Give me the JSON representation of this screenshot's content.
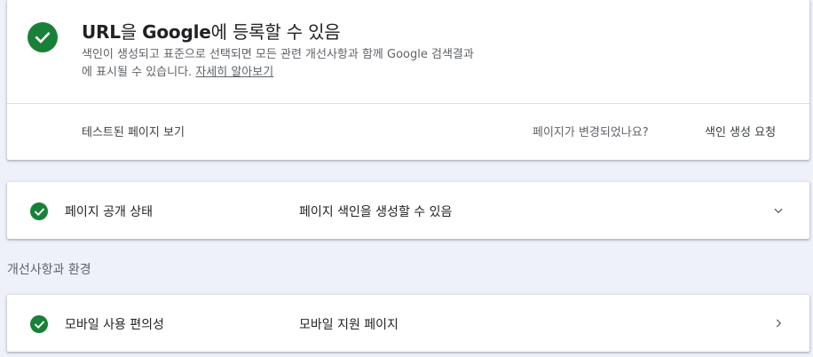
{
  "main": {
    "title_bold": "URL",
    "title_rest_1": "을 ",
    "title_bold_2": "Google",
    "title_rest_2": "에 등록할 수 있음",
    "desc_line1": "색인이 생성되고 표준으로 선택되면 모든 관련 개선사항과 함께 Google 검색결과",
    "desc_line2": "에 표시될 수 있습니다. ",
    "learn_more": "자세히 알아보기",
    "view_tested_page": "테스트된 페이지 보기",
    "page_changed_question": "페이지가 변경되었나요?",
    "request_indexing": "색인 생성 요청",
    "status_icon": "check-circle-icon",
    "status_color": "#188038"
  },
  "page_index": {
    "label": "페이지 공개 상태",
    "value": "페이지 색인을 생성할 수 있음",
    "icon": "check-circle-icon",
    "chevron": "chevron-down-icon"
  },
  "enhancements": {
    "heading": "개선사항과 환경",
    "mobile": {
      "label": "모바일 사용 편의성",
      "value": "모바일 지원 페이지",
      "icon": "check-circle-icon",
      "chevron": "chevron-right-icon"
    }
  }
}
